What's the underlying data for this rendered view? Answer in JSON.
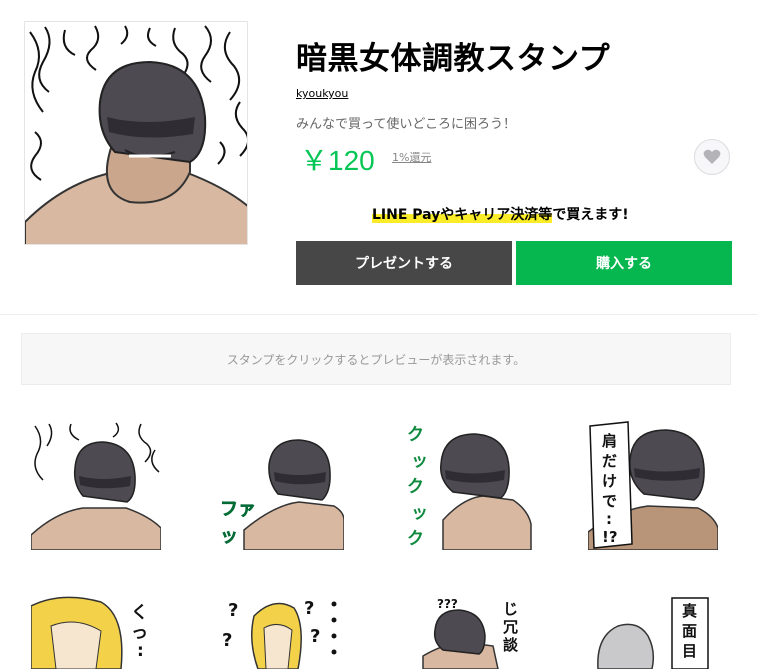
{
  "product": {
    "title": "暗黒女体調教スタンプ",
    "author": "kyoukyou",
    "description": "みんなで買って使いどころに困ろう！",
    "price": "￥120",
    "price_back": "1%還元",
    "promo_highlight": "LINE Payやキャリア決済等",
    "promo_rest": "で買えます!"
  },
  "buttons": {
    "present": "プレゼントする",
    "buy": "購入する"
  },
  "preview_notice": "スタンプをクリックするとプレビューが表示されます。",
  "stickers": [
    {
      "caption": ""
    },
    {
      "caption": "ファッ"
    },
    {
      "caption": "クックック"
    },
    {
      "caption": "肩だけで・・・!?"
    },
    {
      "caption": "くっ・・・!"
    },
    {
      "caption": "? ? ? ?"
    },
    {
      "caption": "???  じ、冗談"
    },
    {
      "caption": "真面目だ"
    }
  ],
  "icons": {
    "favorite": "heart-icon"
  },
  "colors": {
    "accent": "#06c755",
    "buy": "#06b74f",
    "present": "#474747",
    "highlight": "#fbec2a"
  }
}
